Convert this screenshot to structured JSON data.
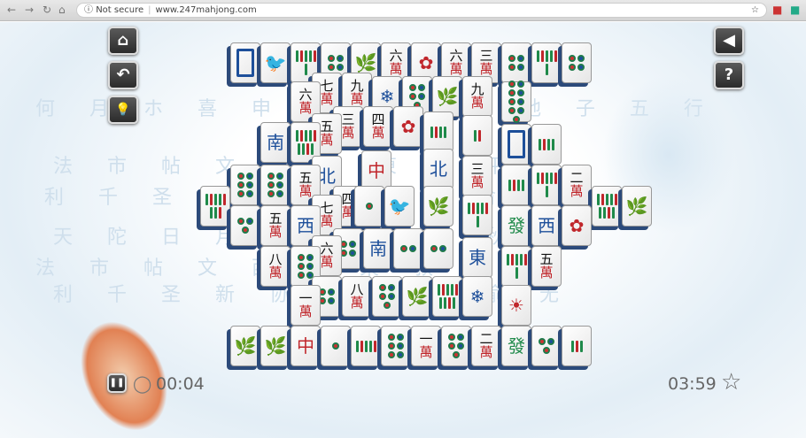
{
  "browser": {
    "security": "Not secure",
    "url": "www.247mahjong.com"
  },
  "buttons": {
    "home": "⌂",
    "undo": "↶",
    "hint": "💡",
    "sound": "◀",
    "help": "?",
    "pause": "❚❚",
    "star": "☆"
  },
  "timer": "00:04",
  "best_time": "03:59",
  "bg_text": [
    "何 月 ホ 喜 申 世 秋 生 苗 地 子 五 行",
    "法 市 帖 文 西 夏 東 叔 平 南",
    "利 千 圣 新 协 德 行 安 俞 无",
    "天 陀 日 月 友 吉 申 世 秋 生"
  ],
  "tiles": [
    "white",
    "bird",
    "bam:6",
    "dots:4",
    "plant",
    "wan:六",
    "flower",
    "wan:六",
    "wan:三",
    "dots:4",
    "bam:6",
    "dots:4",
    "wan:六",
    "wan:七",
    "wan:九",
    "snow",
    "dots:5",
    "plant",
    "wan:九",
    "dots:9",
    "wind:南",
    "bam:9",
    "wan:五",
    "wan:三",
    "wan:四",
    "flower",
    "bam:4",
    "bam:2",
    "white",
    "bam:4",
    "dots:6",
    "dots:6",
    "wan:五",
    "wind:北",
    "red:中",
    "wind:北",
    "wan:三",
    "bam:4",
    "bam:6",
    "wan:二",
    "bam:8",
    "wan:七",
    "wan:四",
    "dots:1",
    "bird",
    "plant",
    "bam:6",
    "bam:9",
    "plant",
    "dots:3",
    "wan:五",
    "wind:西",
    "grn:發",
    "wind:西",
    "flower",
    "wan:八",
    "dots:6",
    "wan:六",
    "dots:4",
    "wind:南",
    "dots:2",
    "dots:2",
    "wind:東",
    "bam:6",
    "wan:五",
    "wan:一",
    "dots:4",
    "wan:八",
    "dots:5",
    "plant",
    "bam:9",
    "snow",
    "sun",
    "plant",
    "plant",
    "red:中",
    "dots:1",
    "bam:5",
    "dots:6",
    "wan:一",
    "dots:5",
    "wan:二",
    "grn:發",
    "dots:3",
    "bam:3"
  ]
}
